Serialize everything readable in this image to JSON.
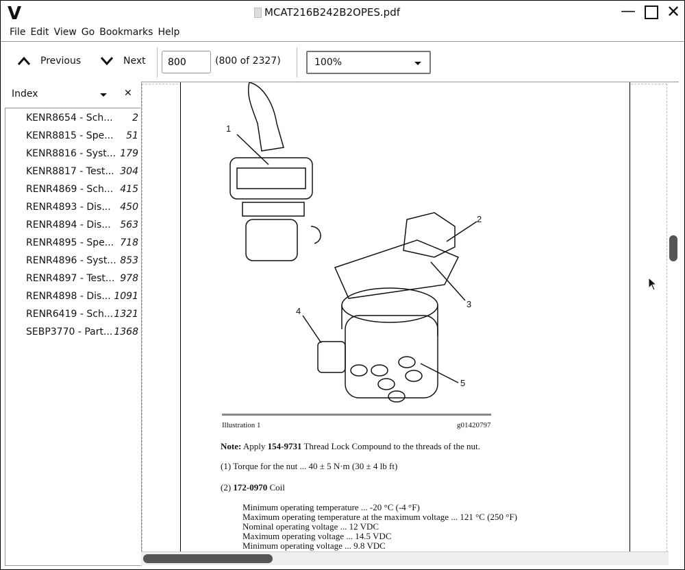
{
  "window": {
    "title": "MCAT216B242B2OPES.pdf",
    "logo": "V"
  },
  "menu": [
    "File",
    "Edit",
    "View",
    "Go",
    "Bookmarks",
    "Help"
  ],
  "toolbar": {
    "previous": "Previous",
    "next": "Next",
    "page_value": "800",
    "page_count": "(800 of 2327)",
    "zoom": "100%"
  },
  "sidebar": {
    "title": "Index",
    "items": [
      {
        "label": "KENR8654 - Sch...",
        "page": "2"
      },
      {
        "label": "KENR8815 - Spe...",
        "page": "51"
      },
      {
        "label": "KENR8816 - Syst...",
        "page": "179"
      },
      {
        "label": "KENR8817 - Test...",
        "page": "304"
      },
      {
        "label": "RENR4869 - Sch...",
        "page": "415"
      },
      {
        "label": "RENR4893 - Dis...",
        "page": "450"
      },
      {
        "label": "RENR4894 - Dis...",
        "page": "563"
      },
      {
        "label": "RENR4895 - Spe...",
        "page": "718"
      },
      {
        "label": "RENR4896 - Syst...",
        "page": "853"
      },
      {
        "label": "RENR4897 - Test...",
        "page": "978"
      },
      {
        "label": "RENR4898 - Dis...",
        "page": "1091"
      },
      {
        "label": "RENR6419 - Sch...",
        "page": "1321"
      },
      {
        "label": "SEBP3770 - Part...",
        "page": "1368"
      }
    ]
  },
  "document": {
    "callouts": [
      "1",
      "2",
      "3",
      "4",
      "5"
    ],
    "caption_left": "Illustration 1",
    "caption_right": "g01420797",
    "note_label": "Note:",
    "note_pre": " Apply ",
    "note_part": "154-9731",
    "note_post": " Thread Lock Compound to the threads of the nut.",
    "item1": "(1) Torque for the nut ... 40 ± 5 N·m (30 ± 4 lb ft)",
    "item2_pre": "(2) ",
    "item2_part": "172-0970",
    "item2_post": " Coil",
    "specs": [
      "Minimum operating temperature ... -20 °C (-4 °F)",
      "Maximum operating temperature at the maximum voltage ... 121 °C (250 °F)",
      "Nominal operating voltage ... 12 VDC",
      "Maximum operating voltage ... 14.5 VDC",
      "Minimum operating voltage ... 9.8 VDC"
    ]
  }
}
